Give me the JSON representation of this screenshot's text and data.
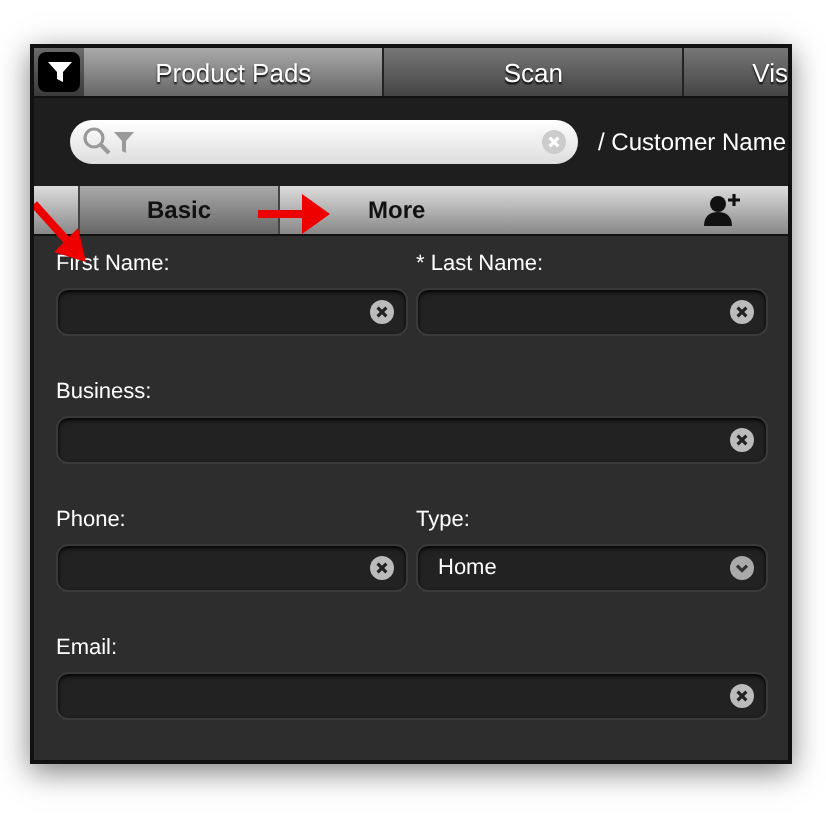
{
  "top_tabs": [
    {
      "label": "Product Pads",
      "selected": true
    },
    {
      "label": "Scan",
      "selected": false
    },
    {
      "label": "Vis",
      "selected": false
    }
  ],
  "search": {
    "suffix": "/ Customer Name"
  },
  "sub_tabs": [
    {
      "label": "Basic",
      "selected": true
    },
    {
      "label": "More",
      "selected": false
    }
  ],
  "form_rows": [
    {
      "fields": [
        {
          "label": "First Name:",
          "kind": "text"
        },
        {
          "label": "* Last Name:",
          "kind": "text"
        }
      ]
    },
    {
      "fields": [
        {
          "label": "Business:",
          "kind": "text"
        }
      ]
    },
    {
      "fields": [
        {
          "label": "Phone:",
          "kind": "text"
        },
        {
          "label": "Type:",
          "kind": "select",
          "value": "Home"
        }
      ]
    },
    {
      "fields": [
        {
          "label": "Email:",
          "kind": "text"
        }
      ]
    }
  ]
}
